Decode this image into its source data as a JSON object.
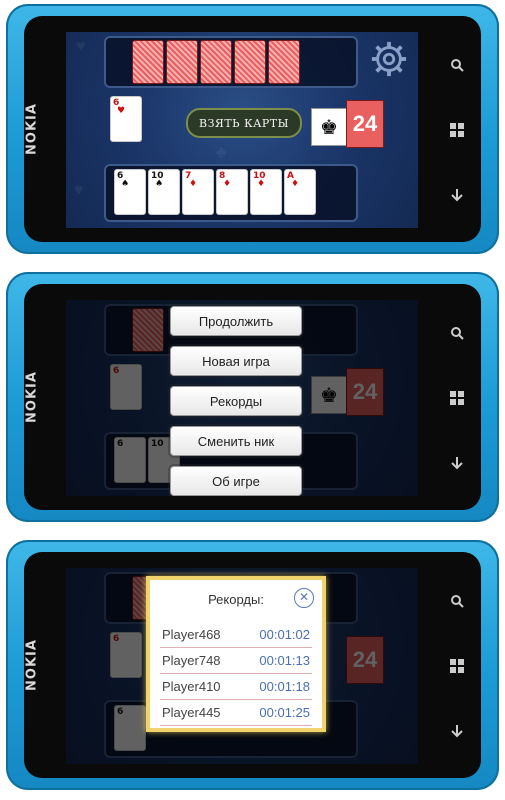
{
  "phone": {
    "brand": "NOKIA"
  },
  "game": {
    "take_button": "ВЗЯТЬ КАРТЫ",
    "deck_count": "24",
    "player_hand": [
      {
        "rank": "6",
        "suit": "♠",
        "color": "black"
      },
      {
        "rank": "10",
        "suit": "♠",
        "color": "black"
      },
      {
        "rank": "7",
        "suit": "♦",
        "color": "red"
      },
      {
        "rank": "8",
        "suit": "♦",
        "color": "red"
      },
      {
        "rank": "10",
        "suit": "♦",
        "color": "red"
      },
      {
        "rank": "A",
        "suit": "♦",
        "color": "red"
      }
    ],
    "table_card": {
      "rank": "6",
      "suit": "♥",
      "color": "red"
    },
    "opponent_cards_count": 5
  },
  "menu": {
    "items": [
      "Продолжить",
      "Новая игра",
      "Рекорды",
      "Сменить ник",
      "Об игре"
    ]
  },
  "records": {
    "title": "Рекорды:",
    "close": "✕",
    "rows": [
      {
        "name": "Player468",
        "time": "00:01:02"
      },
      {
        "name": "Player748",
        "time": "00:01:13"
      },
      {
        "name": "Player410",
        "time": "00:01:18"
      },
      {
        "name": "Player445",
        "time": "00:01:25"
      }
    ]
  },
  "softkeys": [
    "search-icon",
    "windows-icon",
    "back-icon"
  ],
  "colors": {
    "phone": "#1b9ad4",
    "table": "#1a3466",
    "card_back": "#e86060",
    "dialog_border": "#f0d36a"
  }
}
